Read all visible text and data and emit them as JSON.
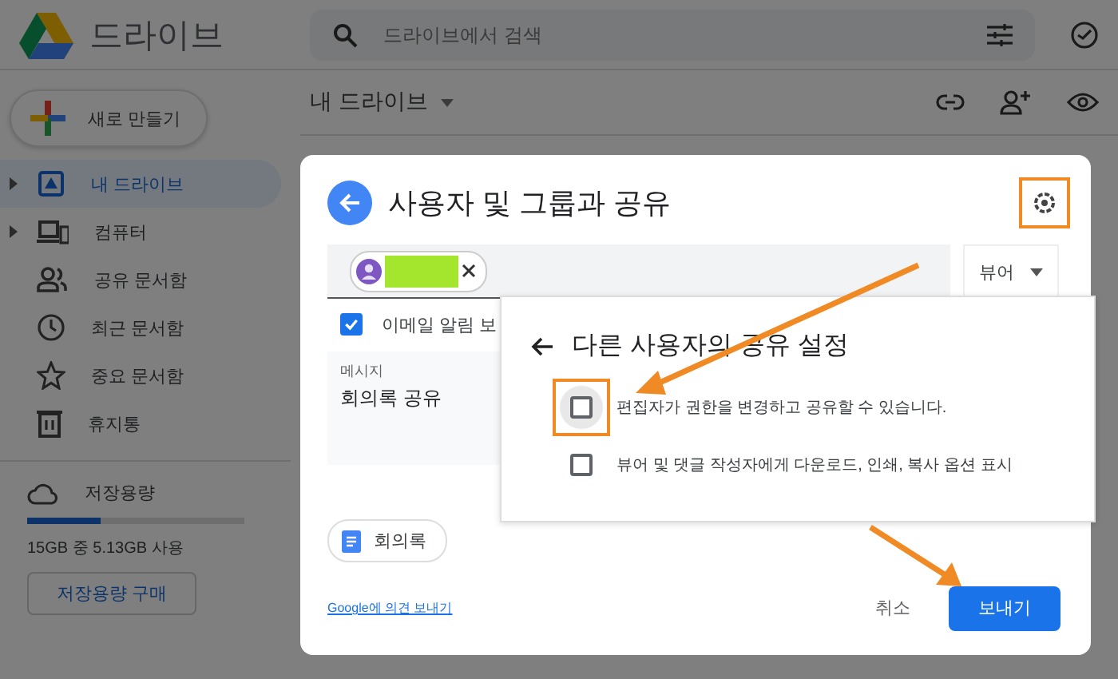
{
  "app": {
    "name": "드라이브"
  },
  "search": {
    "placeholder": "드라이브에서 검색"
  },
  "new_button": "새로 만들기",
  "sidebar": {
    "items": [
      {
        "label": "내 드라이브",
        "kind": "drive",
        "expandable": true,
        "selected": true
      },
      {
        "label": "컴퓨터",
        "kind": "computer",
        "expandable": true,
        "selected": false
      },
      {
        "label": "공유 문서함",
        "kind": "people",
        "expandable": false,
        "selected": false
      },
      {
        "label": "최근 문서함",
        "kind": "clock",
        "expandable": false,
        "selected": false
      },
      {
        "label": "중요 문서함",
        "kind": "star",
        "expandable": false,
        "selected": false
      },
      {
        "label": "휴지통",
        "kind": "trash",
        "expandable": false,
        "selected": false
      }
    ]
  },
  "storage": {
    "label": "저장용량",
    "level": 0.34,
    "usage": "15GB 중 5.13GB 사용",
    "buy_button": "저장용량 구매"
  },
  "breadcrumb": "내 드라이브",
  "dialog": {
    "title": "사용자 및 그룹과 공유",
    "settings_highlighted": true,
    "recipient": {
      "redacted": true
    },
    "role": "뷰어",
    "notify": {
      "label": "이메일 알림 보",
      "checked": true
    },
    "message": {
      "label": "메시지",
      "value": "회의록 공유"
    },
    "attachment": "회의록",
    "feedback_link": "Google에 의견 보내기",
    "cancel": "취소",
    "send": "보내기"
  },
  "settings_panel": {
    "title": "다른 사용자의 공유 설정",
    "options": [
      {
        "label": "편집자가 권한을 변경하고 공유할 수 있습니다.",
        "checked": false,
        "highlighted": true
      },
      {
        "label": "뷰어 및 댓글 작성자에게 다운로드, 인쇄, 복사 옵션 표시",
        "checked": false,
        "highlighted": false
      }
    ]
  }
}
